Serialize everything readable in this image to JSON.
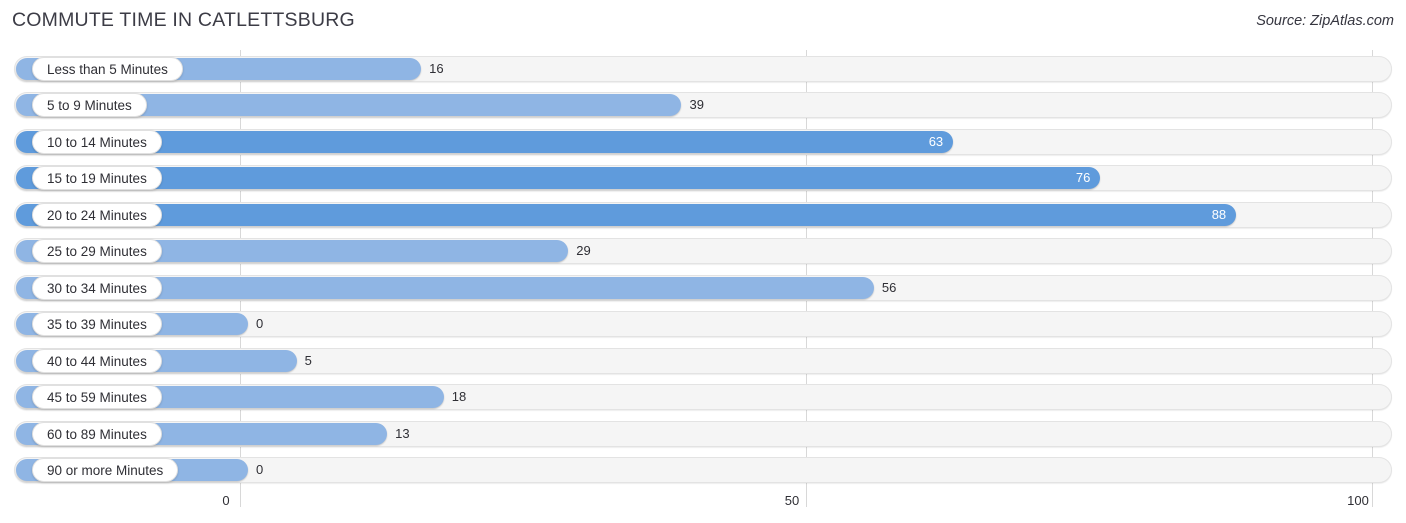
{
  "header": {
    "title": "COMMUTE TIME IN CATLETTSBURG",
    "source": "Source: ZipAtlas.com"
  },
  "colors": {
    "bar_light": "#8fb5e4",
    "bar_dark": "#5f9bdc",
    "track": "#f5f5f5",
    "gridline": "#d8d8d8",
    "title_text": "#3c3c46",
    "value_text_outside": "#2f2f35",
    "value_text_inside": "#ffffff"
  },
  "chart_data": {
    "type": "bar",
    "orientation": "horizontal",
    "title": "COMMUTE TIME IN CATLETTSBURG",
    "xlabel": "",
    "ylabel": "",
    "xlim": [
      0,
      100
    ],
    "xticks": [
      0,
      50,
      100
    ],
    "xtick_labels": [
      "0",
      "50",
      "100"
    ],
    "grid": true,
    "legend": "none",
    "categories": [
      "Less than 5 Minutes",
      "5 to 9 Minutes",
      "10 to 14 Minutes",
      "15 to 19 Minutes",
      "20 to 24 Minutes",
      "25 to 29 Minutes",
      "30 to 34 Minutes",
      "35 to 39 Minutes",
      "40 to 44 Minutes",
      "45 to 59 Minutes",
      "60 to 89 Minutes",
      "90 or more Minutes"
    ],
    "values": [
      16,
      39,
      63,
      76,
      88,
      29,
      56,
      0,
      5,
      18,
      13,
      0
    ],
    "value_labels": [
      "16",
      "39",
      "63",
      "76",
      "88",
      "29",
      "56",
      "0",
      "5",
      "18",
      "13",
      "0"
    ]
  },
  "rows": [
    {
      "label": "Less than 5 Minutes",
      "value": 16,
      "value_label": "16",
      "inside": false,
      "shade": "light"
    },
    {
      "label": "5 to 9 Minutes",
      "value": 39,
      "value_label": "39",
      "inside": false,
      "shade": "light"
    },
    {
      "label": "10 to 14 Minutes",
      "value": 63,
      "value_label": "63",
      "inside": true,
      "shade": "dark"
    },
    {
      "label": "15 to 19 Minutes",
      "value": 76,
      "value_label": "76",
      "inside": true,
      "shade": "dark"
    },
    {
      "label": "20 to 24 Minutes",
      "value": 88,
      "value_label": "88",
      "inside": true,
      "shade": "dark"
    },
    {
      "label": "25 to 29 Minutes",
      "value": 29,
      "value_label": "29",
      "inside": false,
      "shade": "light"
    },
    {
      "label": "30 to 34 Minutes",
      "value": 56,
      "value_label": "56",
      "inside": false,
      "shade": "light"
    },
    {
      "label": "35 to 39 Minutes",
      "value": 0,
      "value_label": "0",
      "inside": false,
      "shade": "light"
    },
    {
      "label": "40 to 44 Minutes",
      "value": 5,
      "value_label": "5",
      "inside": false,
      "shade": "light"
    },
    {
      "label": "45 to 59 Minutes",
      "value": 18,
      "value_label": "18",
      "inside": false,
      "shade": "light"
    },
    {
      "label": "60 to 89 Minutes",
      "value": 13,
      "value_label": "13",
      "inside": false,
      "shade": "light"
    },
    {
      "label": "90 or more Minutes",
      "value": 0,
      "value_label": "0",
      "inside": false,
      "shade": "light"
    }
  ]
}
